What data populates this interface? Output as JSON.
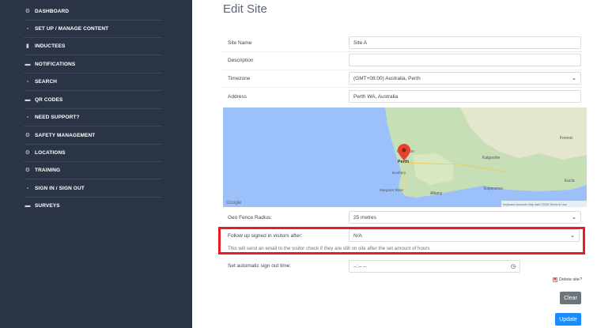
{
  "sidebar": {
    "items": [
      {
        "label": "DASHBOARD",
        "icon": "gear-icon",
        "glyph": "⚙"
      },
      {
        "label": "SET UP / MANAGE CONTENT",
        "icon": "document-icon",
        "glyph": "▫"
      },
      {
        "label": "INDUCTEES",
        "icon": "person-icon",
        "glyph": "▮"
      },
      {
        "label": "NOTIFICATIONS",
        "icon": "chat-icon",
        "glyph": "▬"
      },
      {
        "label": "SEARCH",
        "icon": "document-icon",
        "glyph": "▫"
      },
      {
        "label": "QR CODES",
        "icon": "chat-icon",
        "glyph": "▬"
      },
      {
        "label": "NEED SUPPORT?",
        "icon": "document-icon",
        "glyph": "▫"
      },
      {
        "label": "SAFETY MANAGEMENT",
        "icon": "gear-icon",
        "glyph": "⚙"
      },
      {
        "label": "LOCATIONS",
        "icon": "gear-icon",
        "glyph": "⚙"
      },
      {
        "label": "TRAINING",
        "icon": "gear-icon",
        "glyph": "⚙"
      },
      {
        "label": "SIGN IN / SIGN OUT",
        "icon": "document-icon",
        "glyph": "▫"
      },
      {
        "label": "SURVEYS",
        "icon": "chat-icon",
        "glyph": "▬"
      }
    ]
  },
  "main": {
    "title": "Edit Site",
    "site_name": {
      "label": "Site Name",
      "value": "Site A"
    },
    "description": {
      "label": "Description",
      "value": ""
    },
    "timezone": {
      "label": "Timezone",
      "value": "(GMT+08:00) Australia, Perth"
    },
    "address": {
      "label": "Address",
      "value": "Perth WA, Australia"
    },
    "map": {
      "places": [
        "Perth",
        "Geraldton",
        "Kalgoorlie",
        "Esperance",
        "Albany",
        "Margaret River",
        "Bunbury",
        "Forrest",
        "Eucla"
      ],
      "attribution": "Google",
      "footer": "Keyboard shortcuts   Map data ©2024   Terms of Use"
    },
    "geofence": {
      "label": "Geo Fence Radius:",
      "value": "25 metres"
    },
    "follow_up": {
      "label": "Follow up signed in visitors after:",
      "value": "N/A",
      "note": "This will send an email to the visitor check if they are still on site after the set amount of hours"
    },
    "auto_signout": {
      "label": "Set automatic sign out time:",
      "value": "--:-- --"
    },
    "delete_label": "Delete site?",
    "clear_label": "Clear",
    "update_label": "Update"
  },
  "colors": {
    "sidebar_bg": "#2b3444",
    "highlight": "#e41e26",
    "update_btn": "#1a8cff",
    "clear_btn": "#6c757d"
  }
}
